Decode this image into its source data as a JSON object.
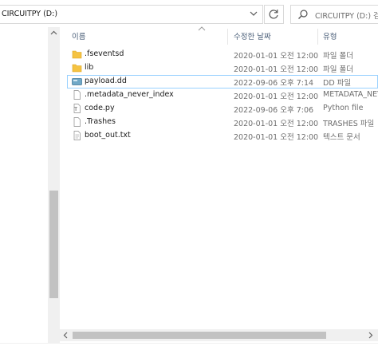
{
  "address": {
    "path": "CIRCUITPY (D:)"
  },
  "search": {
    "placeholder": "CIRCUITPY (D:) 검..."
  },
  "columns": {
    "name": "이름",
    "date": "수정한 날짜",
    "type": "유형"
  },
  "files": [
    {
      "icon": "folder-icon",
      "name": ".fseventsd",
      "date": "2020-01-01 오전 12:00",
      "type": "파일 폴더"
    },
    {
      "icon": "folder-icon",
      "name": "lib",
      "date": "2020-01-01 오전 12:00",
      "type": "파일 폴더"
    },
    {
      "icon": "dd-file-icon",
      "name": "payload.dd",
      "date": "2022-09-06 오후 7:14",
      "type": "DD 파일",
      "selected": true
    },
    {
      "icon": "file-icon",
      "name": ".metadata_never_index",
      "date": "2020-01-01 오전 12:00",
      "type": "METADATA_NEV"
    },
    {
      "icon": "python-file-icon",
      "name": "code.py",
      "date": "2022-09-06 오후 7:06",
      "type": "Python file"
    },
    {
      "icon": "file-icon",
      "name": ".Trashes",
      "date": "2020-01-01 오전 12:00",
      "type": "TRASHES 파일"
    },
    {
      "icon": "text-file-icon",
      "name": "boot_out.txt",
      "date": "2020-01-01 오전 12:00",
      "type": "텍스트 문서"
    }
  ],
  "colors": {
    "folder": "#f5c342",
    "selection_border": "#99d1ff",
    "header_text": "#4c607a"
  }
}
